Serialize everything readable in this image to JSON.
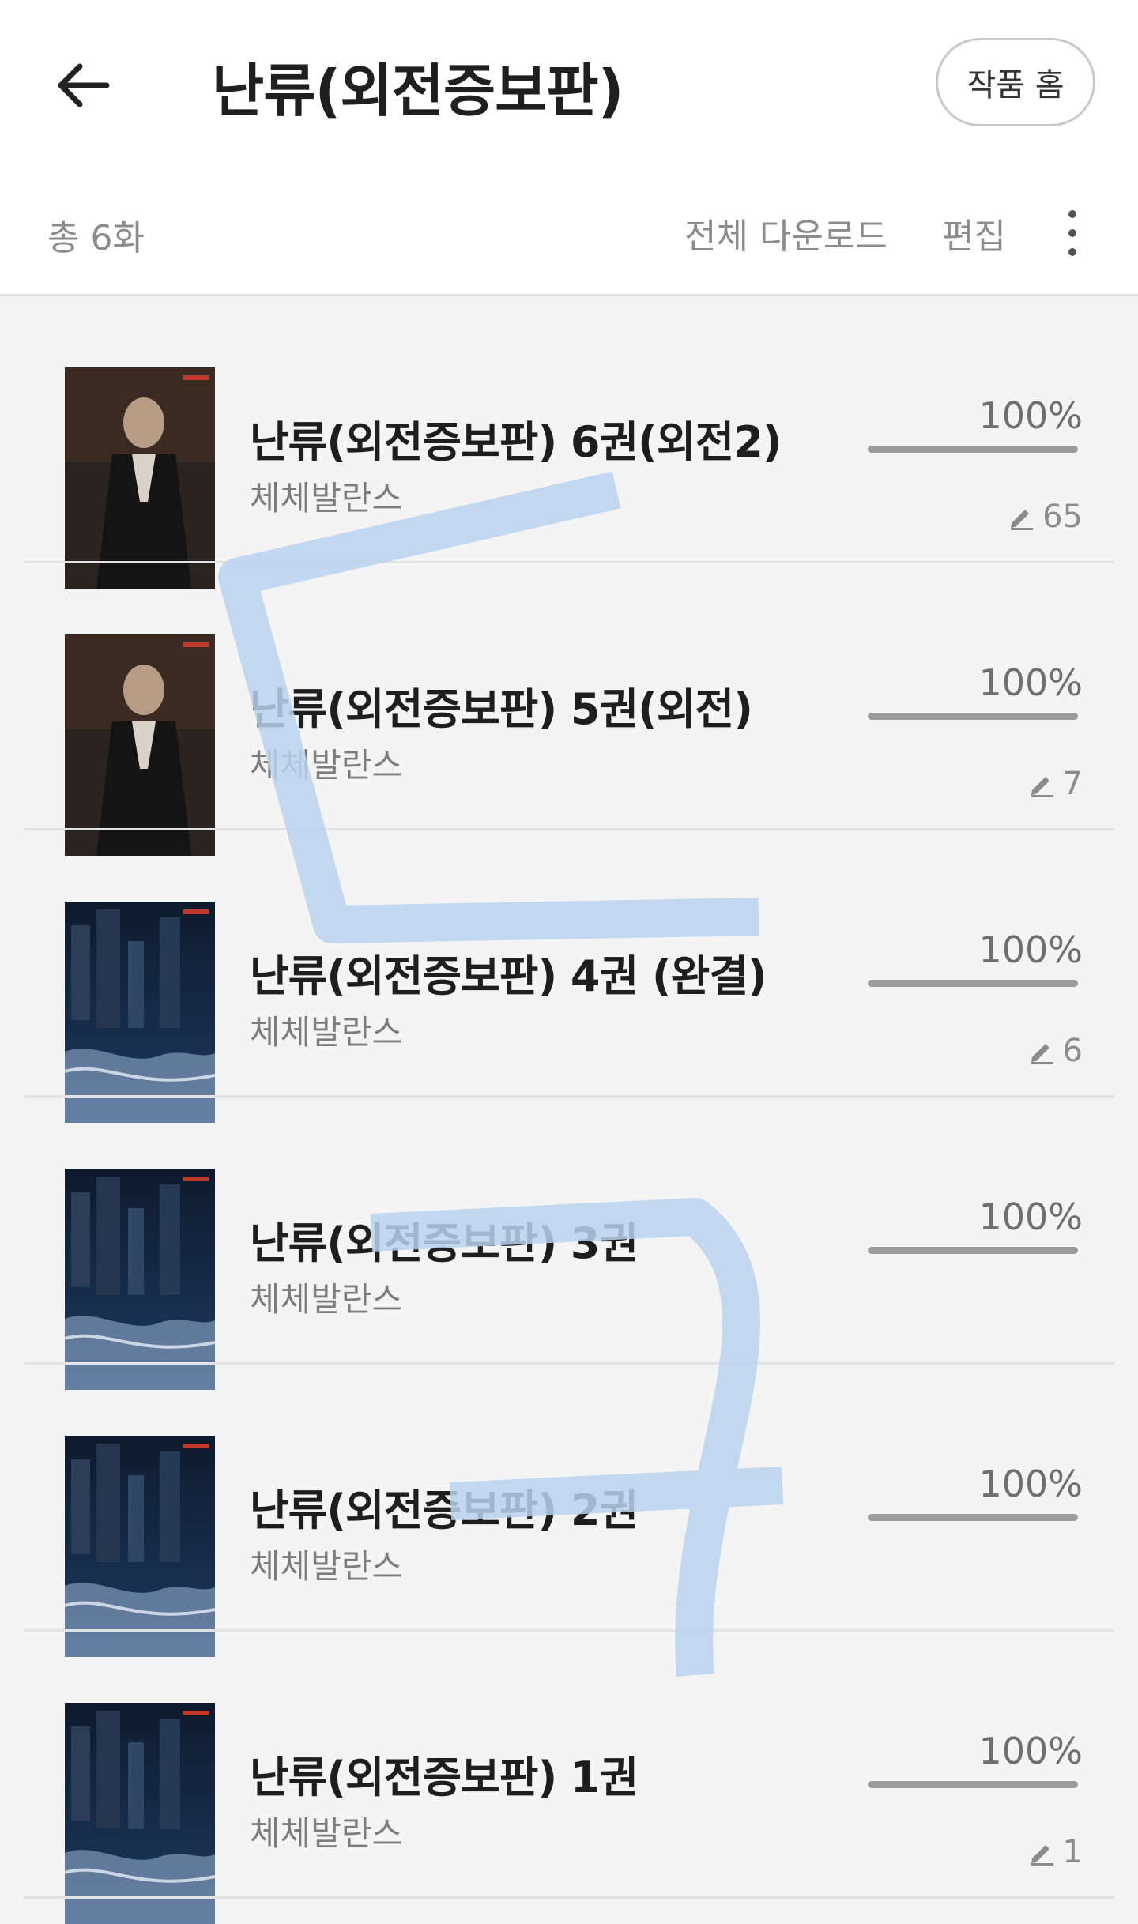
{
  "header": {
    "title": "난류(외전증보판)",
    "home_label": "작품 홈"
  },
  "toolbar": {
    "total_label": "총 6화",
    "download_label": "전체 다운로드",
    "edit_label": "편집"
  },
  "items": [
    {
      "title": "난류(외전증보판) 6권(외전2)",
      "author": "체체발란스",
      "progress_label": "100%",
      "progress": 1.0,
      "memo_count": "65",
      "cover": "dark-portrait"
    },
    {
      "title": "난류(외전증보판) 5권(외전)",
      "author": "체체발란스",
      "progress_label": "100%",
      "progress": 1.0,
      "memo_count": "7",
      "cover": "dark-portrait"
    },
    {
      "title": "난류(외전증보판) 4권 (완결)",
      "author": "체체발란스",
      "progress_label": "100%",
      "progress": 1.0,
      "memo_count": "6",
      "cover": "city-night"
    },
    {
      "title": "난류(외전증보판) 3권",
      "author": "체체발란스",
      "progress_label": "100%",
      "progress": 1.0,
      "memo_count": "",
      "cover": "city-night"
    },
    {
      "title": "난류(외전증보판) 2권",
      "author": "체체발란스",
      "progress_label": "100%",
      "progress": 1.0,
      "memo_count": "",
      "cover": "city-night"
    },
    {
      "title": "난류(외전증보판) 1권",
      "author": "체체발란스",
      "progress_label": "100%",
      "progress": 1.0,
      "memo_count": "1",
      "cover": "city-night"
    }
  ],
  "colors": {
    "accent_stroke": "#b9d2ee",
    "progress_fill": "#9b9b9b"
  }
}
